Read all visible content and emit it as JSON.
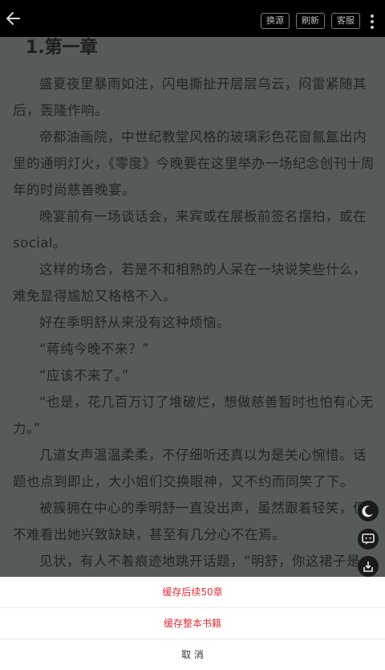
{
  "toolbar": {
    "back_icon": "back-arrow-icon",
    "change_source_label": "换源",
    "refresh_label": "刷新",
    "customer_service_label": "客服",
    "more_icon": "more-vertical-icon"
  },
  "chapter": {
    "title": "1.第一章",
    "paragraphs": [
      "盛夏夜里暴雨如注，闪电撕扯开层层乌云，闷雷紧随其后，轰隆作响。",
      "帝都油画院，中世纪教堂风格的玻璃彩色花窗氤氲出内里的通明灯火，《零度》今晚要在这里举办一场纪念创刊十周年的时尚慈善晚宴。",
      "晚宴前有一场谈话会，来宾或在展板前签名摆拍，或在social。",
      "这样的场合，若是不和相熟的人呆在一块说笑些什么，难免显得尴尬又格格不入。",
      "好在季明舒从来没有这种烦恼。",
      "“蒋纯今晚不来？”",
      "“应该不来了。”",
      "“也是，花几百万订了堆破烂，想做慈善暂时也怕有心无力。”",
      "几道女声温温柔柔，不仔细听还真以为是关心惋惜。话题也点到即止，大小姐们交换眼神，又不约而同笑了下。",
      "被簇拥在中心的季明舒一直没出声，虽然跟着轻笑，但不难看出她兴致缺缺，甚至有几分心不在焉。",
      "见状，有人不着痕迹地跳开话题，“明舒，你这裙子是"
    ]
  },
  "floating_buttons": {
    "night_mode_icon": "moon-icon",
    "message_icon": "chat-bubble-icon",
    "download_icon": "download-icon"
  },
  "action_sheet": {
    "cache_next_50": "缓存后续50章",
    "cache_whole_book": "缓存整本书籍",
    "cancel": "取 消"
  },
  "colors": {
    "reader_background": "#565b57",
    "toolbar_background": "#000000",
    "accent_red": "#e0303a"
  }
}
